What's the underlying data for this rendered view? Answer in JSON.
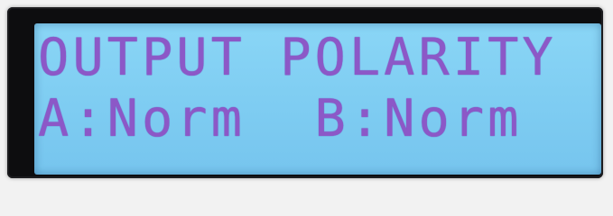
{
  "display": {
    "line1": "OUTPUT POLARITY",
    "line2": "A:Norm  B:Norm"
  },
  "colors": {
    "screen": "#80cef3",
    "text": "#8c58c7",
    "bezel": "#0d0d0f"
  }
}
